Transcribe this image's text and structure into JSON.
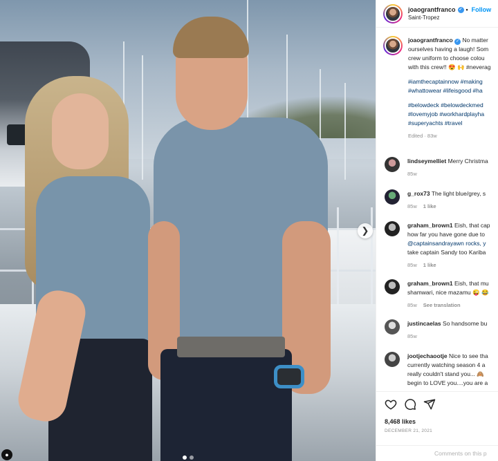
{
  "post": {
    "username": "joaograntfranco",
    "follow_label": "Follow",
    "location": "Saint-Tropez",
    "caption": {
      "username": "joaograntfranco",
      "lines": [
        "No matter",
        "ourselves having a laugh! Som",
        "crew uniform to choose colou",
        "with this crew!! 😍 🙌 #neverag"
      ],
      "tags_block_1": [
        "#iamthecaptainnow #making",
        "#whattowear #lifeisgood #ha"
      ],
      "tags_block_2": [
        "#belowdeck #belowdeckmed",
        "#lovemyjob #workhardplayha",
        "#superyachts #travel"
      ],
      "edited": "Edited · 83w"
    },
    "likes": "8,468 likes",
    "date": "DECEMBER 21, 2021",
    "add_comment_placeholder": "Comments on this p"
  },
  "comments": [
    {
      "username": "lindseymelliet",
      "lines": [
        "Merry Christma"
      ],
      "time": "85w",
      "reply_label": ""
    },
    {
      "username": "g_rox73",
      "lines": [
        "The light blue/grey, s"
      ],
      "time": "85w",
      "likes_label": "1 like"
    },
    {
      "username": "graham_brown1",
      "lines": [
        "Eish, that cap",
        "how far you have gone due to",
        "@captainsandrayawn rocks, y",
        "take captain Sandy too Kariba"
      ],
      "time": "85w",
      "likes_label": "1 like"
    },
    {
      "username": "graham_brown1",
      "lines": [
        "Eish, that mu",
        "shamwari, nice mazamu 😜 😂"
      ],
      "time": "85w",
      "translation_label": "See translation"
    },
    {
      "username": "justincaelas",
      "lines": [
        "So handsome bu"
      ],
      "time": "85w"
    },
    {
      "username": "jootjechaootje",
      "lines": [
        "Nice to see tha",
        "currently watching season 4 a",
        "really couldn't stand you... 🙈",
        "begin to LOVE you....you are a"
      ],
      "time": ""
    }
  ],
  "icons": {
    "verified": "verified-badge-icon",
    "like": "heart-icon",
    "comment": "comment-bubble-icon",
    "share": "paper-plane-icon",
    "carousel_next": "chevron-right-icon"
  },
  "colors": {
    "accent": "#0095f6",
    "link": "#00376b",
    "muted": "#8e8e8e"
  }
}
